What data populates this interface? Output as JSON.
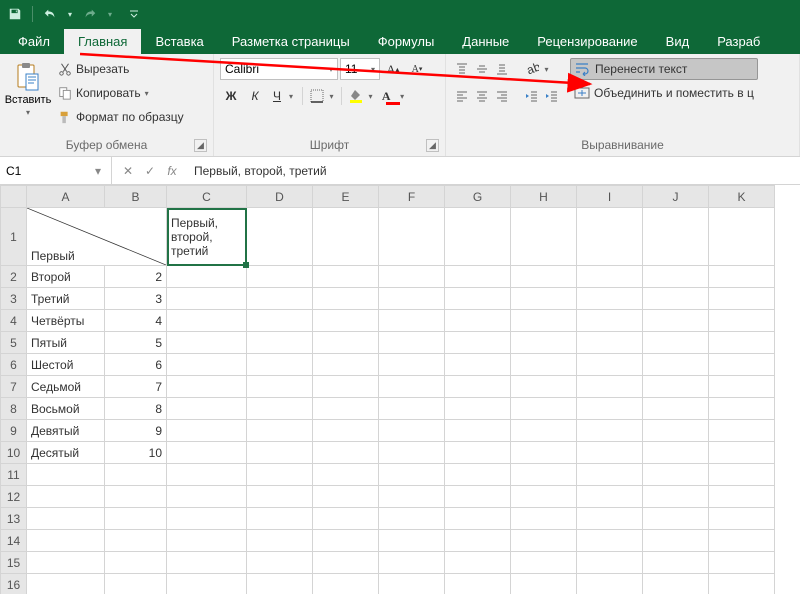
{
  "qat": {
    "undo": "↶",
    "redo": "↷"
  },
  "tabs": [
    "Файл",
    "Главная",
    "Вставка",
    "Разметка страницы",
    "Формулы",
    "Данные",
    "Рецензирование",
    "Вид",
    "Разраб"
  ],
  "active_tab": "Главная",
  "clipboard": {
    "paste": "Вставить",
    "cut": "Вырезать",
    "copy": "Копировать",
    "fmtpaint": "Формат по образцу",
    "group": "Буфер обмена"
  },
  "font": {
    "name": "Calibri",
    "size": "11",
    "bold": "Ж",
    "italic": "К",
    "underline": "Ч",
    "group": "Шрифт"
  },
  "align": {
    "wrap": "Перенести текст",
    "merge": "Объединить и поместить в ц",
    "group": "Выравнивание"
  },
  "namebox": "C1",
  "formula": "Первый, второй, третий",
  "columns": [
    "A",
    "B",
    "C",
    "D",
    "E",
    "F",
    "G",
    "H",
    "I",
    "J",
    "K"
  ],
  "selected_cell": {
    "col": "C",
    "row": 1,
    "value": "Первый,\nвторой,\nтретий"
  },
  "a1_label": "Первый",
  "rows": [
    {
      "n": 2,
      "a": "Второй",
      "b": "2"
    },
    {
      "n": 3,
      "a": "Третий",
      "b": "3"
    },
    {
      "n": 4,
      "a": "Четвёрты",
      "b": "4"
    },
    {
      "n": 5,
      "a": "Пятый",
      "b": "5"
    },
    {
      "n": 6,
      "a": "Шестой",
      "b": "6"
    },
    {
      "n": 7,
      "a": "Седьмой",
      "b": "7"
    },
    {
      "n": 8,
      "a": "Восьмой",
      "b": "8"
    },
    {
      "n": 9,
      "a": "Девятый",
      "b": "9"
    },
    {
      "n": 10,
      "a": "Десятый",
      "b": "10"
    }
  ],
  "blank_rows": [
    11,
    12,
    13
  ],
  "annotation_arrow": {
    "from": "tab-home",
    "to": "wrap-text-button",
    "color": "#ff0000"
  }
}
